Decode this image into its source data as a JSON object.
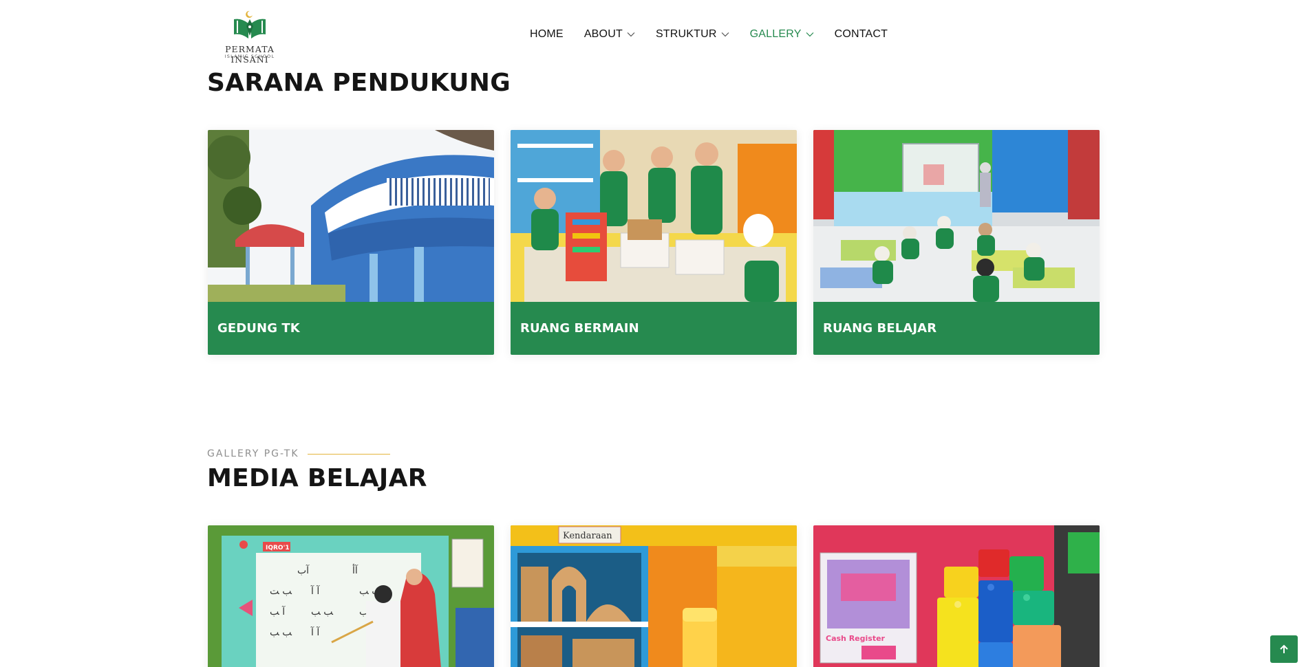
{
  "brand": {
    "name": "PERMATA INSANI",
    "tagline": "ISLAMIC SCHOOL",
    "accent": "#268a4f",
    "accent_line": "#e3b43c"
  },
  "nav": {
    "items": [
      {
        "label": "HOME",
        "has_dropdown": false,
        "active": false
      },
      {
        "label": "ABOUT",
        "has_dropdown": true,
        "active": false
      },
      {
        "label": "STRUKTUR",
        "has_dropdown": true,
        "active": false
      },
      {
        "label": "GALLERY",
        "has_dropdown": true,
        "active": true
      },
      {
        "label": "CONTACT",
        "has_dropdown": false,
        "active": false
      }
    ]
  },
  "sarana": {
    "title": "SARANA PENDUKUNG",
    "cards": [
      {
        "caption": "GEDUNG TK"
      },
      {
        "caption": "RUANG BERMAIN"
      },
      {
        "caption": "RUANG BELAJAR"
      }
    ]
  },
  "media": {
    "eyebrow": "GALLERY PG-TK",
    "title": "MEDIA BELAJAR",
    "cards": [
      {
        "sign": "IQRO'1"
      },
      {
        "sign": "Kendaraan"
      },
      {
        "sign": "Cash Register"
      }
    ]
  },
  "icons": {
    "scroll_top": "arrow-up-icon",
    "dropdown": "chevron-down-icon"
  }
}
